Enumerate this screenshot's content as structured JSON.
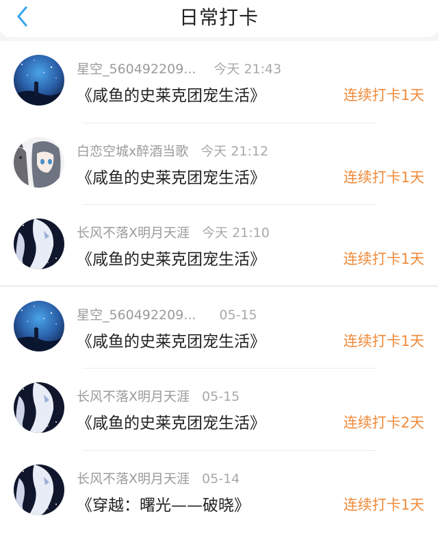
{
  "header": {
    "title": "日常打卡",
    "back_icon": "chevron-left-icon",
    "accent": "#3aa7ef"
  },
  "colors": {
    "streak": "#f08a3a",
    "meta": "#9a9a9a",
    "book": "#222222"
  },
  "checkins": [
    {
      "user": "星空_560492209...",
      "time": "今天 21:43",
      "book": "《咸鱼的史莱克团宠生活》",
      "streak": "连续打卡1天",
      "avatar": "starry-sky-avatar"
    },
    {
      "user": "白恋空城x醉酒当歌",
      "time": "今天 21:12",
      "book": "《咸鱼的史莱克团宠生活》",
      "streak": "连续打卡1天",
      "avatar": "anime-girl-cat-avatar"
    },
    {
      "user": "长风不落X明月天涯",
      "time": "今天 21:10",
      "book": "《咸鱼的史莱克团宠生活》",
      "streak": "连续打卡1天",
      "avatar": "white-hair-anime-avatar"
    },
    {
      "user": "星空_560492209...",
      "time": "05-15",
      "book": "《咸鱼的史莱克团宠生活》",
      "streak": "连续打卡1天",
      "avatar": "starry-sky-avatar"
    },
    {
      "user": "长风不落X明月天涯",
      "time": "05-15",
      "book": "《咸鱼的史莱克团宠生活》",
      "streak": "连续打卡2天",
      "avatar": "white-hair-anime-avatar"
    },
    {
      "user": "长风不落X明月天涯",
      "time": "05-14",
      "book": "《穿越：曙光——破晓》",
      "streak": "连续打卡1天",
      "avatar": "white-hair-anime-avatar"
    }
  ]
}
